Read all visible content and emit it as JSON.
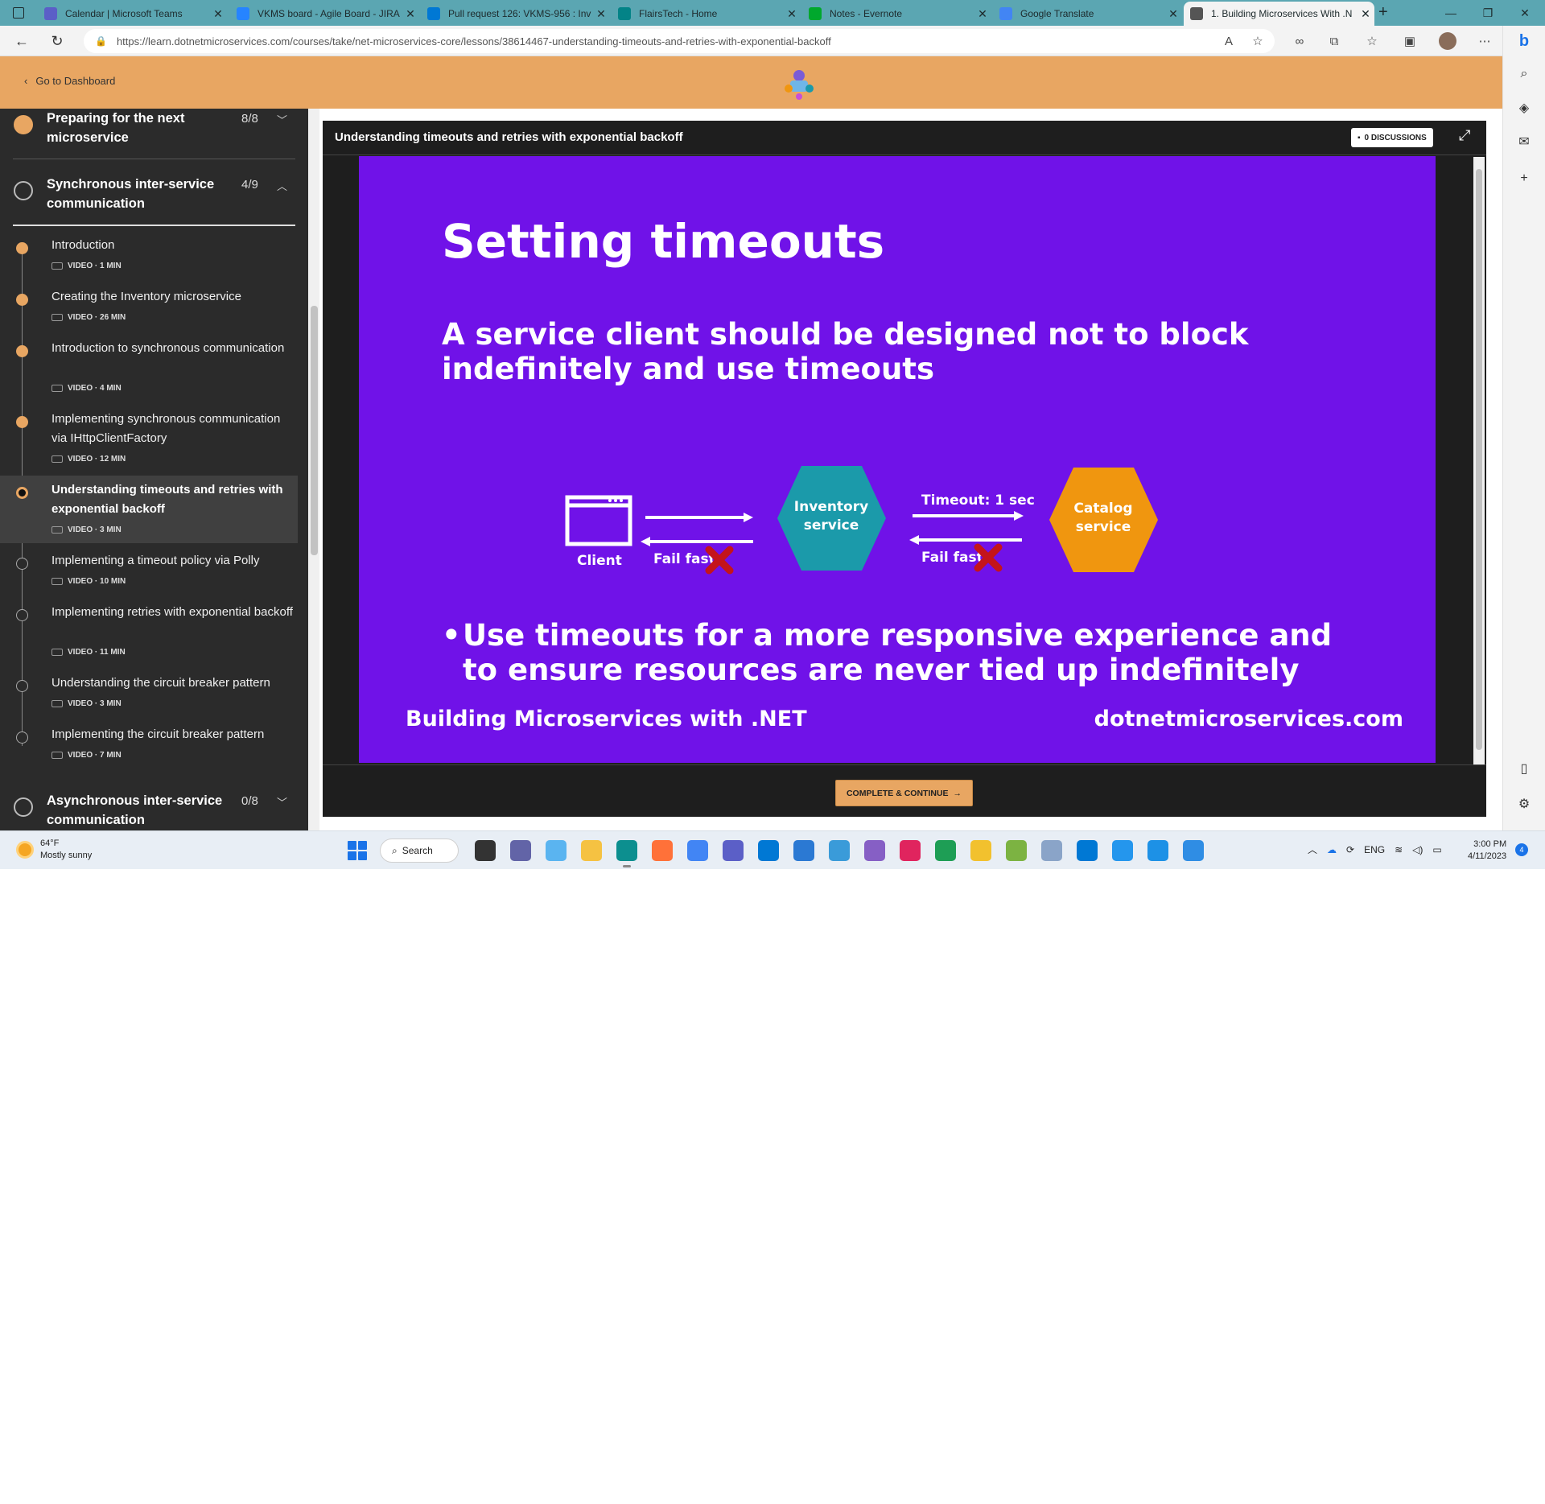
{
  "browser": {
    "tabs": [
      {
        "label": "Calendar | Microsoft Teams",
        "color": "#5b5fc7"
      },
      {
        "label": "VKMS board - Agile Board - JIRA",
        "color": "#2684ff"
      },
      {
        "label": "Pull request 126: VKMS-956 : Inv",
        "color": "#0078d4"
      },
      {
        "label": "FlairsTech - Home",
        "color": "#038387"
      },
      {
        "label": "Notes - Evernote",
        "color": "#00a82d"
      },
      {
        "label": "Google Translate",
        "color": "#4285f4"
      },
      {
        "label": "1. Building Microservices With .N",
        "color": "#555555"
      }
    ],
    "url": "https://learn.dotnetmicroservices.com/courses/take/net-microservices-core/lessons/38614467-understanding-timeouts-and-retries-with-exponential-backoff"
  },
  "header": {
    "dashboard_link": "Go to Dashboard"
  },
  "sidebar": {
    "sections": [
      {
        "title": "Preparing for the next microservice",
        "count": "8/8",
        "done": true,
        "expanded": false
      },
      {
        "title": "Synchronous inter-service communication",
        "count": "4/9",
        "done": false,
        "expanded": true
      },
      {
        "title": "Asynchronous inter-service communication",
        "count": "0/8",
        "done": false,
        "expanded": false
      }
    ],
    "lessons": [
      {
        "title": "Introduction",
        "meta": "VIDEO · 1 MIN",
        "status": "done"
      },
      {
        "title": "Creating the Inventory microservice",
        "meta": "VIDEO · 26 MIN",
        "status": "done"
      },
      {
        "title": "Introduction to synchronous communication",
        "meta": "VIDEO · 4 MIN",
        "status": "done"
      },
      {
        "title": "Implementing synchronous communication via IHttpClientFactory",
        "meta": "VIDEO · 12 MIN",
        "status": "done"
      },
      {
        "title": "Understanding timeouts and retries with exponential backoff",
        "meta": "VIDEO · 3 MIN",
        "status": "current"
      },
      {
        "title": "Implementing a timeout policy via Polly",
        "meta": "VIDEO · 10 MIN",
        "status": "todo"
      },
      {
        "title": "Implementing retries with exponential backoff",
        "meta": "VIDEO · 11 MIN",
        "status": "todo"
      },
      {
        "title": "Understanding the circuit breaker pattern",
        "meta": "VIDEO · 3 MIN",
        "status": "todo"
      },
      {
        "title": "Implementing the circuit breaker pattern",
        "meta": "VIDEO · 7 MIN",
        "status": "todo"
      }
    ]
  },
  "player": {
    "title": "Understanding timeouts and retries with exponential backoff",
    "discussions": "0 DISCUSSIONS",
    "complete_button": "COMPLETE & CONTINUE"
  },
  "slide": {
    "title": "Setting timeouts",
    "subtitle": "A service client should be designed not to block indefinitely and use timeouts",
    "bullet": "Use timeouts for a more responsive experience and to ensure resources are never tied up indefinitely",
    "footer_left": "Building Microservices with .NET",
    "footer_right": "dotnetmicroservices.com",
    "background": "#7012e8",
    "diagram": {
      "client": "Client",
      "fail_fast_1": "Fail fast",
      "inventory": [
        "Inventory",
        "service"
      ],
      "timeout": "Timeout: 1 sec",
      "fail_fast_2": "Fail fast",
      "catalog": [
        "Catalog",
        "service"
      ],
      "inventory_color": "#1b9aaa",
      "catalog_color": "#f0960f"
    }
  },
  "taskbar": {
    "temperature": "64°F",
    "weather": "Mostly sunny",
    "search": "Search",
    "language": "ENG",
    "time": "3:00 PM",
    "date": "4/11/2023",
    "notifications": "4"
  }
}
